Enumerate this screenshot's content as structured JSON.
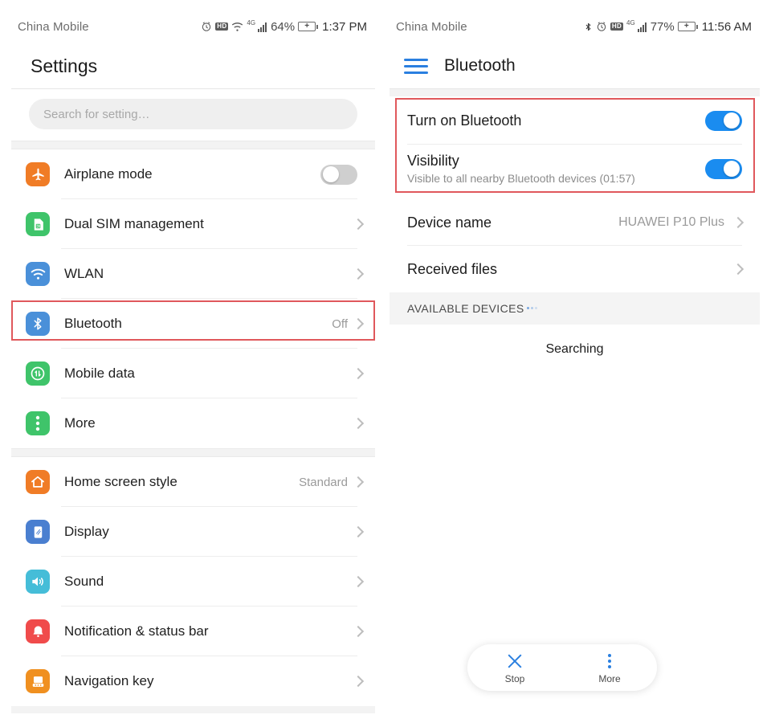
{
  "left": {
    "status": {
      "carrier": "China Mobile",
      "icons": [
        "alarm-icon",
        "hd-icon",
        "wifi-icon",
        "4g-signal-icon"
      ],
      "hd_label": "HD",
      "network_label": "4G",
      "battery_pct": "64%",
      "time": "1:37 PM"
    },
    "appbar": {
      "title": "Settings"
    },
    "search": {
      "placeholder": "Search for setting…"
    },
    "groups": [
      {
        "items": [
          {
            "label": "Airplane mode",
            "icon": "airplane-icon",
            "icon_color": "#f07c26",
            "control": "toggle",
            "toggle_state": "off"
          },
          {
            "label": "Dual SIM management",
            "icon": "sim-card-icon",
            "icon_color": "#3fc46a",
            "control": "chevron"
          },
          {
            "label": "WLAN",
            "icon": "wifi-icon",
            "icon_color": "#4a90d9",
            "control": "chevron"
          },
          {
            "label": "Bluetooth",
            "icon": "bluetooth-icon",
            "icon_color": "#4a90d9",
            "control": "chevron",
            "value": "Off",
            "highlighted": true
          },
          {
            "label": "Mobile data",
            "icon": "mobile-data-icon",
            "icon_color": "#3fc46a",
            "control": "chevron"
          },
          {
            "label": "More",
            "icon": "more-vertical-icon",
            "icon_color": "#3fc46a",
            "control": "chevron"
          }
        ]
      },
      {
        "items": [
          {
            "label": "Home screen style",
            "icon": "home-icon",
            "icon_color": "#f07c26",
            "control": "chevron",
            "value": "Standard"
          },
          {
            "label": "Display",
            "icon": "display-icon",
            "icon_color": "#4a7fd0",
            "control": "chevron"
          },
          {
            "label": "Sound",
            "icon": "sound-icon",
            "icon_color": "#45bdd8",
            "control": "chevron"
          },
          {
            "label": "Notification & status bar",
            "icon": "bell-icon",
            "icon_color": "#f04b4b",
            "control": "chevron"
          },
          {
            "label": "Navigation key",
            "icon": "navigation-key-icon",
            "icon_color": "#f09020",
            "control": "chevron"
          }
        ]
      }
    ]
  },
  "right": {
    "status": {
      "carrier": "China Mobile",
      "icons": [
        "bluetooth-icon",
        "alarm-icon",
        "hd-icon",
        "4g-signal-icon"
      ],
      "hd_label": "HD",
      "network_label": "4G",
      "battery_pct": "77%",
      "time": "11:56 AM"
    },
    "appbar": {
      "menu_icon": "hamburger-menu-icon",
      "title": "Bluetooth"
    },
    "switch_rows": [
      {
        "title": "Turn on Bluetooth",
        "sub": "",
        "toggle_state": "on"
      },
      {
        "title": "Visibility",
        "sub": "Visible to all nearby Bluetooth devices (01:57)",
        "toggle_state": "on"
      }
    ],
    "info_rows": [
      {
        "title": "Device name",
        "value": "HUAWEI P10 Plus",
        "control": "chevron"
      },
      {
        "title": "Received files",
        "value": "",
        "control": "chevron"
      }
    ],
    "section_header": "AVAILABLE DEVICES",
    "searching_label": "Searching",
    "actions": [
      {
        "label": "Stop",
        "icon": "close-x-icon"
      },
      {
        "label": "More",
        "icon": "more-vertical-icon"
      }
    ]
  },
  "colors": {
    "accent_blue": "#1a8cf0",
    "highlight_red": "#e0585c",
    "toggle_off": "#cfcfcf"
  }
}
